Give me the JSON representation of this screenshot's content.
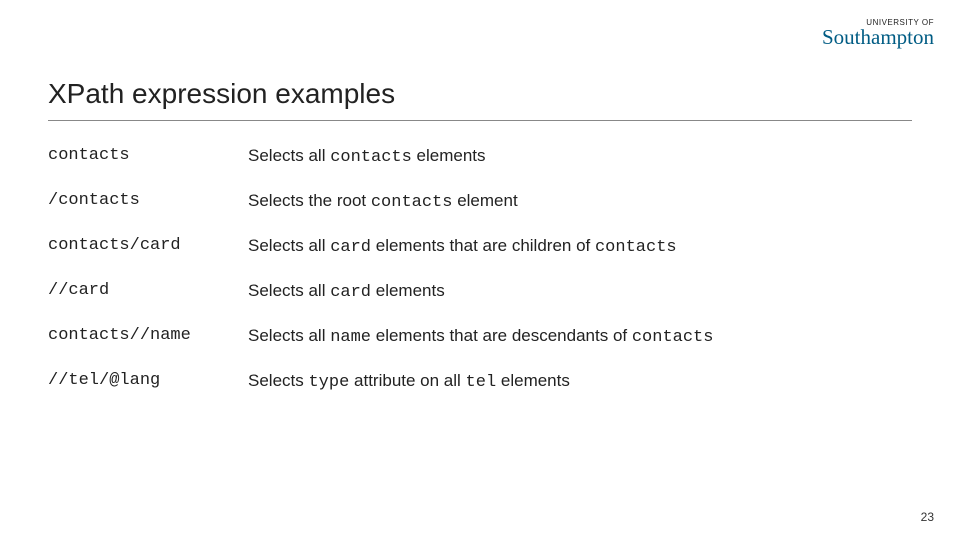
{
  "logo": {
    "top": "UNIVERSITY OF",
    "main_prefix": "S",
    "main_rest": "outhampton"
  },
  "title": "XPath expression examples",
  "rows": [
    {
      "expr": "contacts",
      "d0": "Selects all ",
      "m0": "contacts",
      "d1": " elements",
      "m1": "",
      "d2": ""
    },
    {
      "expr": "/contacts",
      "d0": "Selects the root ",
      "m0": "contacts",
      "d1": " element",
      "m1": "",
      "d2": ""
    },
    {
      "expr": "contacts/card",
      "d0": "Selects all ",
      "m0": "card",
      "d1": " elements that are children of ",
      "m1": "contacts",
      "d2": ""
    },
    {
      "expr": "//card",
      "d0": "Selects all ",
      "m0": "card",
      "d1": " elements",
      "m1": "",
      "d2": ""
    },
    {
      "expr": "contacts//name",
      "d0": "Selects all ",
      "m0": "name",
      "d1": " elements that are descendants of ",
      "m1": "contacts",
      "d2": ""
    },
    {
      "expr": "//tel/@lang",
      "d0": "Selects ",
      "m0": "type",
      "d1": " attribute on all ",
      "m1": "tel",
      "d2": " elements"
    }
  ],
  "page_number": "23"
}
